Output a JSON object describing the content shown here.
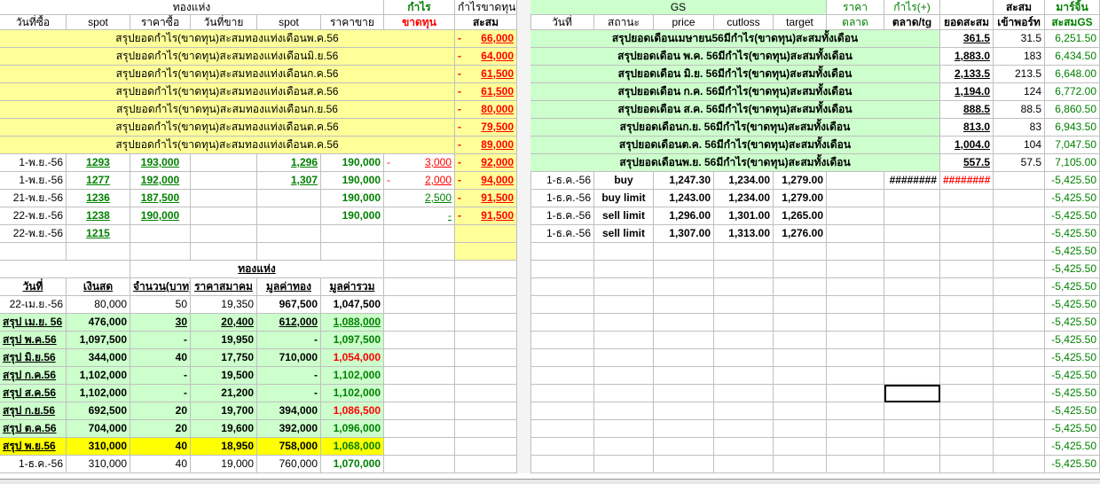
{
  "header": {
    "top_gold": "ทองแห่ง",
    "top_profit": "กำไร",
    "top_profit_cum": "กำไรขาดทุน",
    "top_gs": "GS",
    "top_price": "ราคา",
    "top_profit_plus": "กำไร(+)",
    "top_cum2": "สะสม",
    "top_margin": "มาร์จิ้น",
    "col_buydate": "วันที่ซื้อ",
    "col_spot1": "spot",
    "col_buyprice": "ราคาซื้อ",
    "col_selldate": "วันที่ขาย",
    "col_spot2": "spot",
    "col_sellprice": "ราคาขาย",
    "col_loss": "ขาดทุน",
    "col_cum": "สะสม",
    "col_date": "วันที่",
    "col_status": "สถานะ",
    "col_price": "price",
    "col_cutloss": "cutloss",
    "col_target": "target",
    "col_market": "ตลาด",
    "col_market_tg": "ตลาด/tg",
    "col_cumtotal": "ยอดสะสม",
    "col_portin": "เข้าพอร์ท",
    "col_cumgs": "สะสมGS"
  },
  "gold_summary": [
    {
      "label": "สรุปยอดกำไร(ขาดทุน)สะสมทองแท่งเดือนพ.ค.56",
      "value": "66,000"
    },
    {
      "label": "สรุปยอดกำไร(ขาดทุน)สะสมทองแท่งเดือนมิ.ย.56",
      "value": "64,000"
    },
    {
      "label": "สรุปยอดกำไร(ขาดทุน)สะสมทองแท่งเดือนก.ค.56",
      "value": "61,500"
    },
    {
      "label": "สรุปยอดกำไร(ขาดทุน)สะสมทองแท่งเดือนส.ค.56",
      "value": "61,500"
    },
    {
      "label": "สรุปยอดกำไร(ขาดทุน)สะสมทองแท่งเดือนก.ย.56",
      "value": "80,000"
    },
    {
      "label": "สรุปยอดกำไร(ขาดทุน)สะสมทองแท่งเดือนต.ค.56",
      "value": "79,500"
    },
    {
      "label": "สรุปยอดกำไร(ขาดทุน)สะสมทองแท่งเดือนต.ค.56",
      "value": "89,000"
    }
  ],
  "gs_summary": [
    {
      "label": "สรุปยอดเดือนเมษายน56มีกำไร(ขาดทุน)สะสมทั้งเดือน",
      "total": "361.5",
      "portin": "31.5",
      "cumgs": "6,251.50"
    },
    {
      "label": "สรุปยอดเดือน พ.ค. 56มีกำไร(ขาดทุน)สะสมทั้งเดือน",
      "total": "1,883.0",
      "portin": "183",
      "cumgs": "6,434.50"
    },
    {
      "label": "สรุปยอดเดือน มิ.ย. 56มีกำไร(ขาดทุน)สะสมทั้งเดือน",
      "total": "2,133.5",
      "portin": "213.5",
      "cumgs": "6,648.00"
    },
    {
      "label": "สรุปยอดเดือน ก.ค. 56มีกำไร(ขาดทุน)สะสมทั้งเดือน",
      "total": "1,194.0",
      "portin": "124",
      "cumgs": "6,772.00"
    },
    {
      "label": "สรุปยอดเดือน ส.ค. 56มีกำไร(ขาดทุน)สะสมทั้งเดือน",
      "total": "888.5",
      "portin": "88.5",
      "cumgs": "6,860.50"
    },
    {
      "label": "สรุปยอดเดือนก.ย. 56มีกำไร(ขาดทุน)สะสมทั้งเดือน",
      "total": "813.0",
      "portin": "83",
      "cumgs": "6,943.50"
    },
    {
      "label": "สรุปยอดเดือนต.ค. 56มีกำไร(ขาดทุน)สะสมทั้งเดือน",
      "total": "1,004.0",
      "portin": "104",
      "cumgs": "7,047.50"
    },
    {
      "label": "สรุปยอดเดือนพ.ย. 56มีกำไร(ขาดทุน)สะสมทั้งเดือน",
      "total": "557.5",
      "portin": "57.5",
      "cumgs": "7,105.00"
    }
  ],
  "trades": [
    {
      "buydate": "1-พ.ย.-56",
      "spot1": "1293",
      "buyprice": "193,000",
      "spot2": "1,296",
      "sellprice": "190,000",
      "sign": "-",
      "loss": "3,000",
      "cum_sign": "-",
      "cum": "92,000"
    },
    {
      "buydate": "1-พ.ย.-56",
      "spot1": "1277",
      "buyprice": "192,000",
      "spot2": "1,307",
      "sellprice": "190,000",
      "sign": "-",
      "loss": "2,000",
      "cum_sign": "-",
      "cum": "94,000"
    },
    {
      "buydate": "21-พ.ย.-56",
      "spot1": "1236",
      "buyprice": "187,500",
      "spot2": "",
      "sellprice": "190,000",
      "sign": "",
      "loss": "2,500",
      "cum_sign": "-",
      "cum": "91,500"
    },
    {
      "buydate": "22-พ.ย.-56",
      "spot1": "1238",
      "buyprice": "190,000",
      "spot2": "",
      "sellprice": "190,000",
      "sign": "",
      "loss": "-",
      "cum_sign": "-",
      "cum": "91,500"
    },
    {
      "buydate": "22-พ.ย.-56",
      "spot1": "1215",
      "buyprice": "",
      "spot2": "",
      "sellprice": "",
      "sign": "",
      "loss": "",
      "cum_sign": "",
      "cum": ""
    }
  ],
  "gs_trades": [
    {
      "date": "1-ธ.ค.-56",
      "status": "buy",
      "price": "1,247.30",
      "cutloss": "1,234.00",
      "target": "1,279.00",
      "tg": "########",
      "total": "########"
    },
    {
      "date": "1-ธ.ค.-56",
      "status": "buy limit",
      "price": "1,243.00",
      "cutloss": "1,234.00",
      "target": "1,279.00",
      "tg": "",
      "total": ""
    },
    {
      "date": "1-ธ.ค.-56",
      "status": "sell limit",
      "price": "1,296.00",
      "cutloss": "1,301.00",
      "target": "1,265.00",
      "tg": "",
      "total": ""
    },
    {
      "date": "1-ธ.ค.-56",
      "status": "sell limit",
      "price": "1,307.00",
      "cutloss": "1,313.00",
      "target": "1,276.00",
      "tg": "",
      "total": ""
    }
  ],
  "cumgs_first": "-5,425.50",
  "cumgs_repeat": "-5,425.50",
  "cumgs_last": "-5,425.50",
  "port": {
    "title": "ทองแห่ง",
    "h_date": "วันที่",
    "h_cash": "เงินสด",
    "h_qty": "จำนวน(บาท)",
    "h_price": "ราคาสมาคม",
    "h_gold": "มูลค่าทอง",
    "h_total": "มูลค่ารวม",
    "rows": [
      {
        "date": "22-เม.ย.-56",
        "cash": "80,000",
        "qty": "50",
        "price": "19,350",
        "gold": "967,500",
        "total": "1,047,500",
        "style": "plain",
        "tcolor": "dk"
      },
      {
        "date": "สรุป เม.ย. 56",
        "cash": "476,000",
        "qty": "30",
        "price": "20,400",
        "gold": "612,000",
        "total": "1,088,000",
        "style": "g",
        "tcolor": "gr"
      },
      {
        "date": "สรุป พ.ค.56",
        "cash": "1,097,500",
        "qty": "-",
        "price": "19,950",
        "gold": "-",
        "total": "1,097,500",
        "style": "g",
        "tcolor": "gr"
      },
      {
        "date": "สรุป มิ.ย.56",
        "cash": "344,000",
        "qty": "40",
        "price": "17,750",
        "gold": "710,000",
        "total": "1,054,000",
        "style": "g",
        "tcolor": "rd"
      },
      {
        "date": "สรุป ก.ค.56",
        "cash": "1,102,000",
        "qty": "-",
        "price": "19,500",
        "gold": "-",
        "total": "1,102,000",
        "style": "g",
        "tcolor": "gr"
      },
      {
        "date": "สรุป ส.ค.56",
        "cash": "1,102,000",
        "qty": "-",
        "price": "21,200",
        "gold": "-",
        "total": "1,102,000",
        "style": "g",
        "tcolor": "gr"
      },
      {
        "date": "สรุป ก.ย.56",
        "cash": "692,500",
        "qty": "20",
        "price": "19,700",
        "gold": "394,000",
        "total": "1,086,500",
        "style": "g",
        "tcolor": "rd"
      },
      {
        "date": "สรุป ต.ค.56",
        "cash": "704,000",
        "qty": "20",
        "price": "19,600",
        "gold": "392,000",
        "total": "1,096,000",
        "style": "g",
        "tcolor": "gr"
      },
      {
        "date": "สรุป พ.ย.56",
        "cash": "310,000",
        "qty": "40",
        "price": "18,950",
        "gold": "758,000",
        "total": "1,068,000",
        "style": "Y",
        "tcolor": "gr"
      },
      {
        "date": "1-ธ.ค.-56",
        "cash": "310,000",
        "qty": "40",
        "price": "19,000",
        "gold": "760,000",
        "total": "1,070,000",
        "style": "plain",
        "tcolor": "gr"
      }
    ]
  },
  "colors": {
    "yellow_light": "#ffff99",
    "green_light": "#ccffcc",
    "yellow": "#ffff00",
    "green_text": "#008000",
    "red_text": "#ff0000"
  }
}
